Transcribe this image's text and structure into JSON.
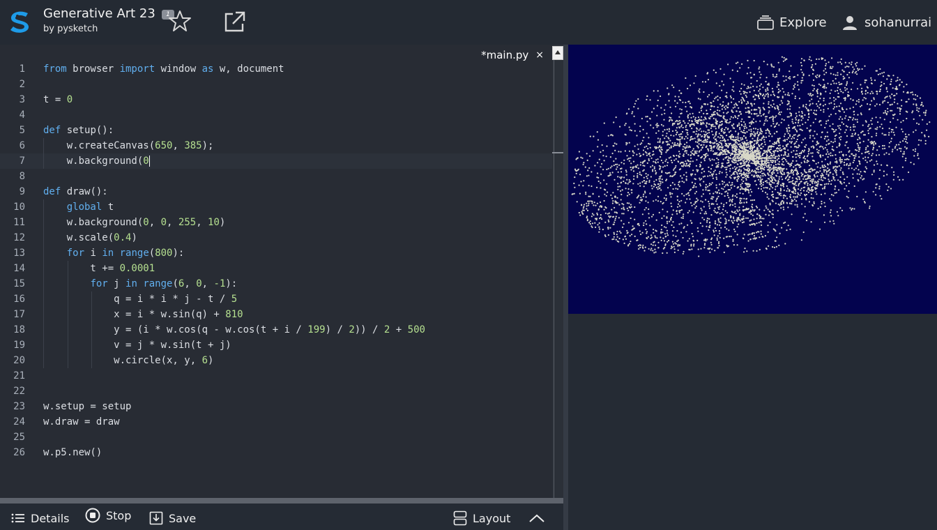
{
  "header": {
    "title": "Generative Art 23",
    "byline": "by pysketch",
    "star_count": "1",
    "nav": {
      "explore": "Explore",
      "username": "sohanurrai"
    }
  },
  "editor": {
    "tab": {
      "filename": "*main.py",
      "close": "×"
    },
    "active_line": 7,
    "lines": [
      {
        "n": "1",
        "tokens": [
          {
            "t": "from",
            "c": "kw"
          },
          {
            "t": " browser "
          },
          {
            "t": "import",
            "c": "kw"
          },
          {
            "t": " window "
          },
          {
            "t": "as",
            "c": "kw"
          },
          {
            "t": " w, document"
          }
        ]
      },
      {
        "n": "2",
        "tokens": []
      },
      {
        "n": "3",
        "tokens": [
          {
            "t": "t = "
          },
          {
            "t": "0",
            "c": "num"
          }
        ]
      },
      {
        "n": "4",
        "tokens": []
      },
      {
        "n": "5",
        "tokens": [
          {
            "t": "def",
            "c": "kw"
          },
          {
            "t": " setup():"
          }
        ]
      },
      {
        "n": "6",
        "indent": 1,
        "tokens": [
          {
            "t": "    w.createCanvas("
          },
          {
            "t": "650",
            "c": "num"
          },
          {
            "t": ", "
          },
          {
            "t": "385",
            "c": "num"
          },
          {
            "t": ");"
          }
        ]
      },
      {
        "n": "7",
        "indent": 1,
        "caret": true,
        "tokens": [
          {
            "t": "    w.background("
          },
          {
            "t": "0",
            "c": "num"
          }
        ]
      },
      {
        "n": "8",
        "tokens": []
      },
      {
        "n": "9",
        "tokens": [
          {
            "t": "def",
            "c": "kw"
          },
          {
            "t": " draw():"
          }
        ]
      },
      {
        "n": "10",
        "indent": 1,
        "tokens": [
          {
            "t": "    "
          },
          {
            "t": "global",
            "c": "kw"
          },
          {
            "t": " t"
          }
        ]
      },
      {
        "n": "11",
        "indent": 1,
        "tokens": [
          {
            "t": "    w.background("
          },
          {
            "t": "0",
            "c": "num"
          },
          {
            "t": ", "
          },
          {
            "t": "0",
            "c": "num"
          },
          {
            "t": ", "
          },
          {
            "t": "255",
            "c": "num"
          },
          {
            "t": ", "
          },
          {
            "t": "10",
            "c": "num"
          },
          {
            "t": ")"
          }
        ]
      },
      {
        "n": "12",
        "indent": 1,
        "tokens": [
          {
            "t": "    w.scale("
          },
          {
            "t": "0.4",
            "c": "num"
          },
          {
            "t": ")"
          }
        ]
      },
      {
        "n": "13",
        "indent": 1,
        "tokens": [
          {
            "t": "    "
          },
          {
            "t": "for",
            "c": "kw"
          },
          {
            "t": " i "
          },
          {
            "t": "in",
            "c": "kw"
          },
          {
            "t": " "
          },
          {
            "t": "range",
            "c": "kw"
          },
          {
            "t": "("
          },
          {
            "t": "800",
            "c": "num"
          },
          {
            "t": "):"
          }
        ]
      },
      {
        "n": "14",
        "indent": 2,
        "tokens": [
          {
            "t": "        t += "
          },
          {
            "t": "0.0001",
            "c": "num"
          }
        ]
      },
      {
        "n": "15",
        "indent": 2,
        "tokens": [
          {
            "t": "        "
          },
          {
            "t": "for",
            "c": "kw"
          },
          {
            "t": " j "
          },
          {
            "t": "in",
            "c": "kw"
          },
          {
            "t": " "
          },
          {
            "t": "range",
            "c": "kw"
          },
          {
            "t": "("
          },
          {
            "t": "6",
            "c": "num"
          },
          {
            "t": ", "
          },
          {
            "t": "0",
            "c": "num"
          },
          {
            "t": ", "
          },
          {
            "t": "-1",
            "c": "num"
          },
          {
            "t": "):"
          }
        ]
      },
      {
        "n": "16",
        "indent": 3,
        "tokens": [
          {
            "t": "            q = i * i * j - t / "
          },
          {
            "t": "5",
            "c": "num"
          }
        ]
      },
      {
        "n": "17",
        "indent": 3,
        "tokens": [
          {
            "t": "            x = i * w.sin(q) + "
          },
          {
            "t": "810",
            "c": "num"
          }
        ]
      },
      {
        "n": "18",
        "indent": 3,
        "tokens": [
          {
            "t": "            y = (i * w.cos(q - w.cos(t + i / "
          },
          {
            "t": "199",
            "c": "num"
          },
          {
            "t": ") / "
          },
          {
            "t": "2",
            "c": "num"
          },
          {
            "t": ")) / "
          },
          {
            "t": "2",
            "c": "num"
          },
          {
            "t": " + "
          },
          {
            "t": "500",
            "c": "num"
          }
        ]
      },
      {
        "n": "19",
        "indent": 3,
        "tokens": [
          {
            "t": "            v = j * w.sin(t + j)"
          }
        ]
      },
      {
        "n": "20",
        "indent": 3,
        "tokens": [
          {
            "t": "            w.circle(x, y, "
          },
          {
            "t": "6",
            "c": "num"
          },
          {
            "t": ")"
          }
        ]
      },
      {
        "n": "21",
        "tokens": []
      },
      {
        "n": "22",
        "tokens": []
      },
      {
        "n": "23",
        "tokens": [
          {
            "t": "w.setup = setup"
          }
        ]
      },
      {
        "n": "24",
        "tokens": [
          {
            "t": "w.draw = draw"
          }
        ]
      },
      {
        "n": "25",
        "tokens": []
      },
      {
        "n": "26",
        "tokens": [
          {
            "t": "w.p5.new()"
          }
        ]
      }
    ]
  },
  "toolbar": {
    "details": "Details",
    "stop": "Stop",
    "save": "Save",
    "layout": "Layout"
  },
  "canvas": {
    "background": "#03034e",
    "dot_color": "#d8d8c8"
  },
  "colors": {
    "app_bg": "#252b34",
    "editor_bg": "#282c34",
    "keyword": "#61afef",
    "number": "#b5e090"
  }
}
